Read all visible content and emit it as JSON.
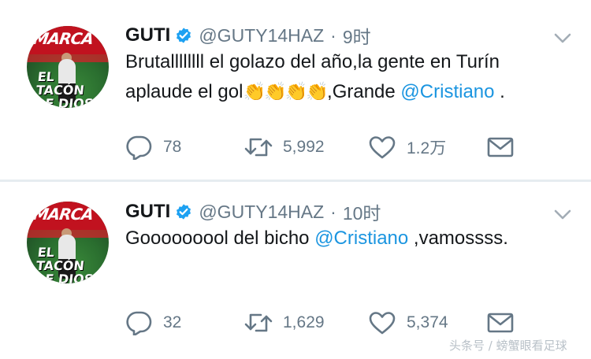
{
  "tweets": [
    {
      "user": {
        "name": "GUTI",
        "handle": "@GUTY14HAZ",
        "avatar": {
          "brand": "MARCA",
          "headline": "EL TACÓN DE DIOS"
        }
      },
      "separator": "·",
      "time": "9时",
      "text": {
        "part1": "Brutallllllll el golazo del año,la gente en Turín aplaude el gol",
        "clap": "👏",
        "part2": ",Grande ",
        "mention": "@Cristiano",
        "part3": " ."
      },
      "actions": {
        "replies": "78",
        "retweets": "5,992",
        "likes": "1.2万"
      }
    },
    {
      "user": {
        "name": "GUTI",
        "handle": "@GUTY14HAZ",
        "avatar": {
          "brand": "MARCA",
          "headline": "EL TACÓN DE DIOS"
        }
      },
      "separator": "·",
      "time": "10时",
      "text": {
        "part1": "Gooooooool del bicho ",
        "mention": "@Cristiano",
        "part2": " ,vamossss."
      },
      "actions": {
        "replies": "32",
        "retweets": "1,629",
        "likes": "5,374"
      }
    }
  ],
  "icons": {
    "verified": "verified-badge-icon",
    "more": "chevron-down-icon",
    "reply": "reply-icon",
    "retweet": "retweet-icon",
    "like": "heart-icon",
    "dm": "envelope-icon"
  },
  "colors": {
    "mention": "#1b95e0",
    "secondary_text": "#657786",
    "verified": "#1da1f2"
  },
  "watermark": "头条号 / 螃蟹眼看足球"
}
